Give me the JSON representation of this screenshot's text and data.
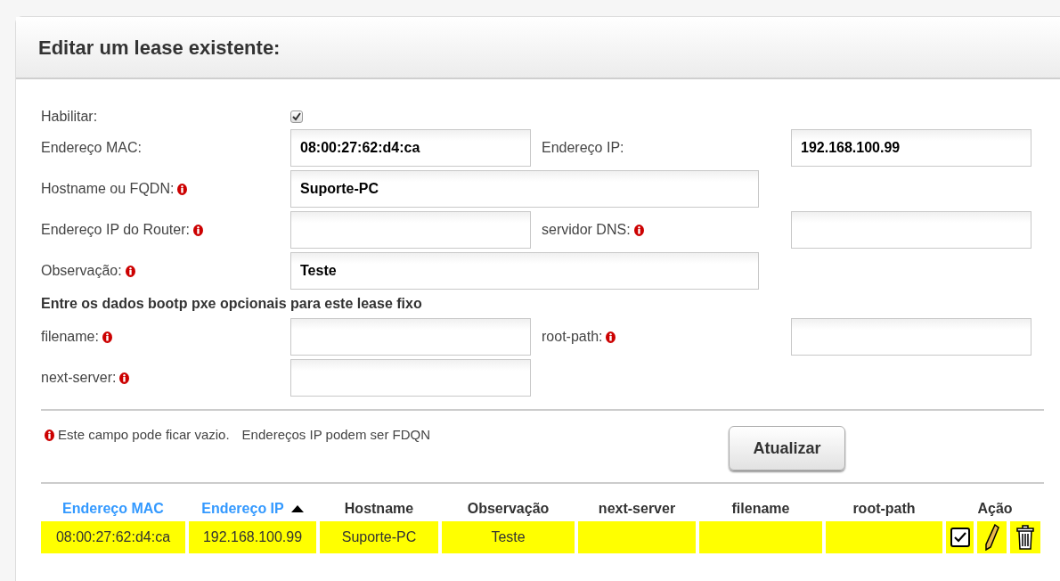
{
  "panel": {
    "title": "Editar um lease existente:"
  },
  "form_rows": [
    [
      {
        "kind": "checkbox",
        "label": "Habilitar:",
        "optional": false,
        "checked": true
      }
    ],
    [
      {
        "kind": "text",
        "label": "Endereço MAC:",
        "optional": false,
        "value": "08:00:27:62:d4:ca"
      },
      {
        "kind": "text",
        "label": "Endereço IP:",
        "optional": false,
        "value": "192.168.100.99"
      }
    ],
    [
      {
        "kind": "wide",
        "label": "Hostname ou FQDN:",
        "optional": true,
        "value": "Suporte-PC"
      }
    ],
    [
      {
        "kind": "text",
        "label": "Endereço IP do Router:",
        "optional": true
      },
      {
        "kind": "text",
        "label": "servidor DNS:",
        "optional": true
      }
    ],
    [
      {
        "kind": "wide",
        "label": "Observação:",
        "optional": true,
        "value": "Teste"
      }
    ],
    [
      {
        "kind": "heading",
        "label": "Entre os dados bootp pxe opcionais para este lease fixo"
      }
    ],
    [
      {
        "kind": "text",
        "label": "filename:",
        "optional": true
      },
      {
        "kind": "text",
        "label": "root-path:",
        "optional": true
      }
    ],
    [
      {
        "kind": "text",
        "label": "next-server:",
        "optional": true
      }
    ]
  ],
  "note": {
    "text": "Este campo pode ficar vazio.",
    "text_2": "Endereços IP podem ser FDQN"
  },
  "submit_button": "Atualizar",
  "table": {
    "columns": [
      {
        "label": "Endereço MAC",
        "link": true,
        "sorted": false
      },
      {
        "label": "Endereço IP",
        "link": true,
        "sorted": true
      },
      {
        "label": "Hostname",
        "link": false,
        "sorted": false
      },
      {
        "label": "Observação",
        "link": false,
        "sorted": false
      },
      {
        "label": "next-server",
        "link": false,
        "sorted": false
      },
      {
        "label": "filename",
        "link": false,
        "sorted": false
      },
      {
        "label": "root-path",
        "link": false,
        "sorted": false
      },
      {
        "label": "Ação",
        "link": false,
        "sorted": false
      }
    ],
    "rows": [
      {
        "highlighted": true,
        "cells": [
          "08:00:27:62:d4:ca",
          "192.168.100.99",
          "Suporte-PC",
          "Teste"
        ],
        "enabled": true
      }
    ]
  }
}
